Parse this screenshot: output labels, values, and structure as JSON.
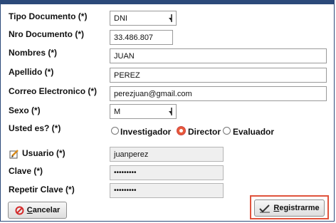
{
  "form": {
    "tipo_documento_label": "Tipo Documento (*)",
    "tipo_documento_value": "DNI",
    "nro_documento_label": "Nro Documento (*)",
    "nro_documento_value": "33.486.807",
    "nombres_label": "Nombres (*)",
    "nombres_value": "JUAN",
    "apellido_label": "Apellido (*)",
    "apellido_value": "PEREZ",
    "correo_label": "Correo Electronico (*)",
    "correo_value": "perezjuan@gmail.com",
    "sexo_label": "Sexo (*)",
    "sexo_value": "M",
    "usted_es_label": "Usted es? (*)",
    "roles": [
      {
        "label": "Investigador",
        "selected": false
      },
      {
        "label": "Director",
        "selected": true
      },
      {
        "label": "Evaluador",
        "selected": false
      }
    ],
    "usuario_label": "Usuario (*)",
    "usuario_value": "juanperez",
    "clave_label": "Clave (*)",
    "clave_value": "•••••••••",
    "repetir_clave_label": "Repetir Clave (*)",
    "repetir_clave_value": "•••••••••"
  },
  "buttons": {
    "cancelar_accel": "C",
    "cancelar_rest": "ancelar",
    "registrarme_accel": "R",
    "registrarme_rest": "egistrarme"
  },
  "colors": {
    "frame": "#2c4a7a",
    "radio_selected": "#e85a3a",
    "cancel_icon": "#d42a2a",
    "highlight": "#e0533c"
  }
}
